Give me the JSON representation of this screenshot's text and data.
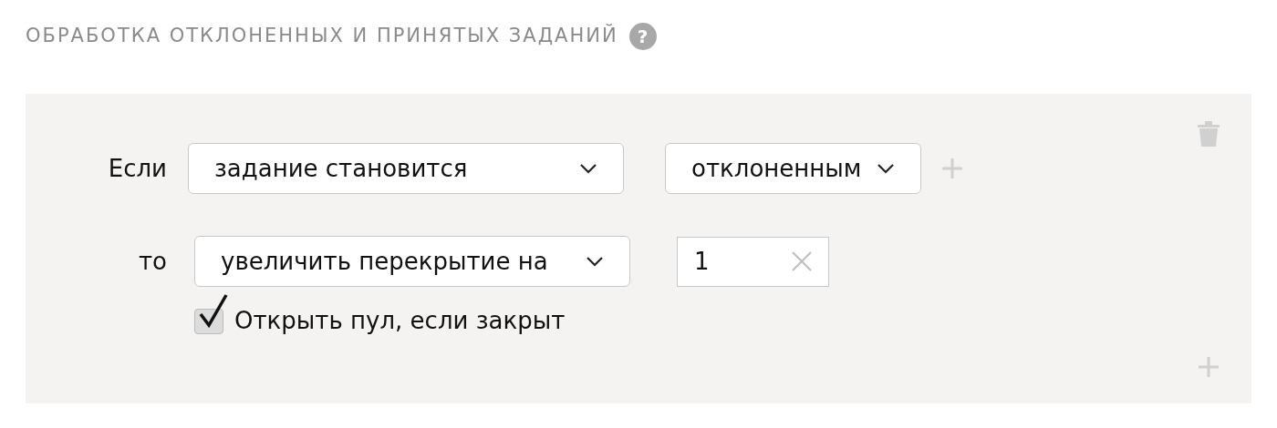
{
  "section": {
    "title": "ОБРАБОТКА ОТКЛОНЕННЫХ И ПРИНЯТЫХ ЗАДАНИЙ",
    "help": "?"
  },
  "rule": {
    "condition": {
      "label": "Если",
      "field": "задание становится",
      "value": "отклоненным"
    },
    "action": {
      "label": "то",
      "operation": "увеличить перекрытие на",
      "amount": "1"
    },
    "option": {
      "label": "Открыть пул, если закрыт",
      "checked": true
    }
  }
}
